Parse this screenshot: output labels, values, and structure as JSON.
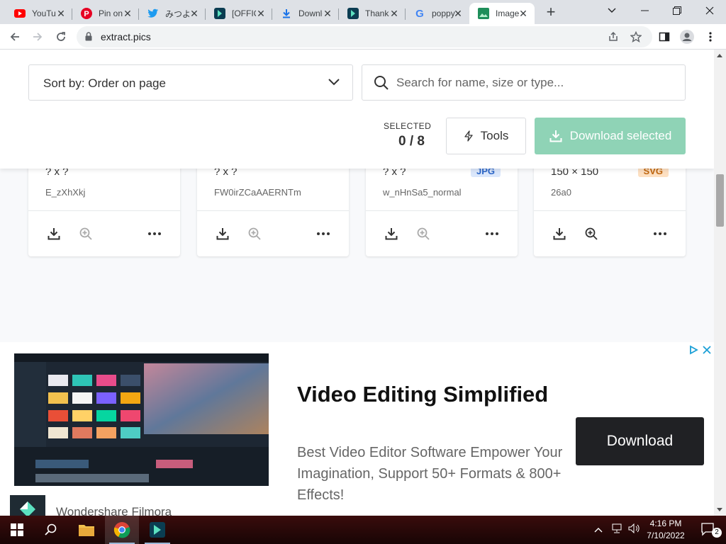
{
  "browser": {
    "tabs": [
      {
        "title": "YouTube",
        "icon": "youtube-icon"
      },
      {
        "title": "Pin on",
        "icon": "pinterest-icon"
      },
      {
        "title": "みつよ",
        "icon": "twitter-icon"
      },
      {
        "title": "[OFFICIAL]",
        "icon": "filmora-icon"
      },
      {
        "title": "Download",
        "icon": "download-icon"
      },
      {
        "title": "Thanks",
        "icon": "filmora-icon"
      },
      {
        "title": "poppy",
        "icon": "google-icon"
      },
      {
        "title": "Image",
        "icon": "extract-pics-icon",
        "active": true
      }
    ],
    "url": "extract.pics"
  },
  "page": {
    "sort_label": "Sort by: Order on page",
    "search_placeholder": "Search for name, size or type...",
    "selected_label": "SELECTED",
    "selected_count": "0 / 8",
    "tools_label": "Tools",
    "download_selected_label": "Download selected",
    "images": [
      {
        "dims": "? x ?",
        "name": "E_zXhXkj",
        "badge": ""
      },
      {
        "dims": "? x ?",
        "name": "FW0irZCaAAERNTm",
        "badge": ""
      },
      {
        "dims": "? x ?",
        "name": "w_nHnSa5_normal",
        "badge": "JPG"
      },
      {
        "dims": "150 × 150",
        "name": "26a0",
        "badge": "SVG"
      }
    ]
  },
  "ad": {
    "headline": "Video Editing Simplified",
    "body": "Best Video Editor Software Empower Your Imagination, Support 50+ Formats & 800+ Effects!",
    "cta": "Download",
    "brand": "Wondershare Filmora"
  },
  "taskbar": {
    "time": "4:16 PM",
    "date": "7/10/2022",
    "notifications": "2"
  },
  "colors": {
    "download_selected_bg": "#8fd3b6",
    "jpg_badge_bg": "#dbe7fb",
    "jpg_badge_fg": "#2c66c8",
    "svg_badge_bg": "#fde0c2",
    "svg_badge_fg": "#c0660e"
  }
}
